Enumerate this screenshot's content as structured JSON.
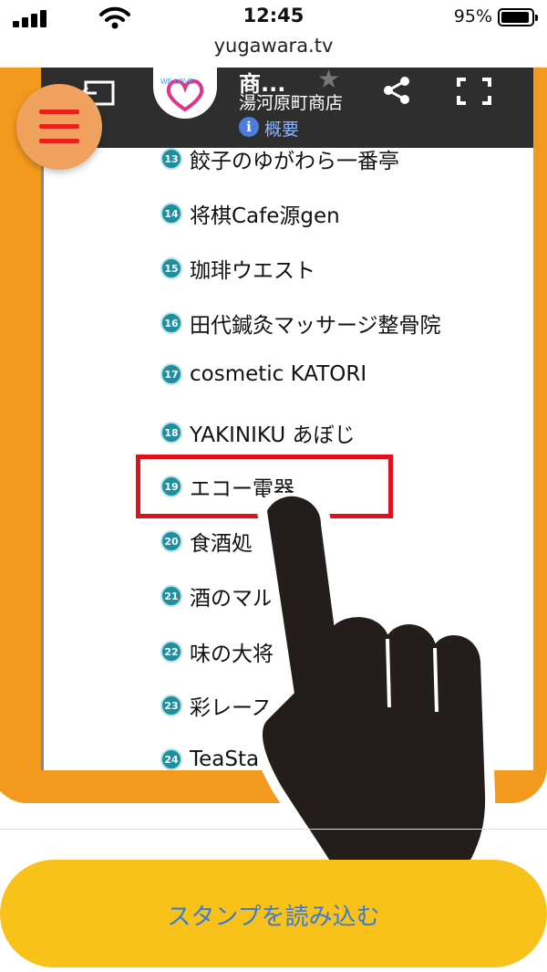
{
  "status_bar": {
    "time": "12:45",
    "battery": "95%",
    "battery_level": 0.95
  },
  "browser": {
    "url": "yugawara.tv"
  },
  "map_header": {
    "title": "商...",
    "subtitle": "湯河原町商店",
    "info_label": "概要",
    "logo_text": "WE LOVE"
  },
  "list": {
    "items": [
      {
        "number": "13",
        "label": "餃子のゆがわら一番亭"
      },
      {
        "number": "14",
        "label": "将棋Cafe源gen"
      },
      {
        "number": "15",
        "label": "珈琲ウエスト"
      },
      {
        "number": "16",
        "label": "田代鍼灸マッサージ整骨院"
      },
      {
        "number": "17",
        "label": "cosmetic KATORI"
      },
      {
        "number": "18",
        "label": "YAKINIKU あぼじ"
      },
      {
        "number": "19",
        "label": "エコー電器"
      },
      {
        "number": "20",
        "label": "食酒処 うさぎ"
      },
      {
        "number": "21",
        "label": "酒のマルマート"
      },
      {
        "number": "22",
        "label": "味の大将"
      },
      {
        "number": "23",
        "label": "彩レース"
      },
      {
        "number": "24",
        "label": "TeaStand"
      }
    ],
    "highlighted_index": 6
  },
  "bottom": {
    "stamp_button_label": "スタンプを読み込む"
  },
  "colors": {
    "frame_orange": "#f39a1e",
    "menu_button": "#f0a15d",
    "menu_lines": "#e8211c",
    "highlight_red": "#e0111a",
    "badge_teal": "#1f8fa0",
    "stamp_button": "#f8c21a",
    "stamp_label": "#3b7ccf"
  },
  "icons": [
    "signal-icon",
    "wifi-icon",
    "battery-icon",
    "back-icon",
    "star-icon",
    "info-icon",
    "share-icon",
    "fullscreen-icon",
    "hamburger-menu-icon",
    "pointing-hand-icon"
  ]
}
